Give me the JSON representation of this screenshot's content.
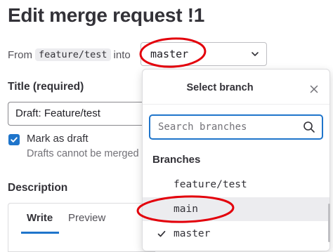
{
  "page": {
    "title": "Edit merge request !1"
  },
  "branch_row": {
    "from_label": "From",
    "source_branch": "feature/test",
    "into_label": "into",
    "target_branch": "master"
  },
  "title_field": {
    "label": "Title (required)",
    "value": "Draft: Feature/test"
  },
  "draft": {
    "checked": true,
    "label": "Mark as draft",
    "help": "Drafts cannot be merged"
  },
  "description": {
    "label": "Description",
    "tabs": [
      "Write",
      "Preview"
    ],
    "active_tab": "Write"
  },
  "branch_dropdown": {
    "title": "Select branch",
    "search_placeholder": "Search branches",
    "group_label": "Branches",
    "items": [
      {
        "label": "feature/test",
        "selected": false,
        "hovered": false
      },
      {
        "label": "main",
        "selected": false,
        "hovered": true
      },
      {
        "label": "master",
        "selected": true,
        "hovered": false
      }
    ]
  },
  "colors": {
    "accent": "#1f75cb",
    "annotation": "#e3000b",
    "hover_bg": "#ececef"
  }
}
